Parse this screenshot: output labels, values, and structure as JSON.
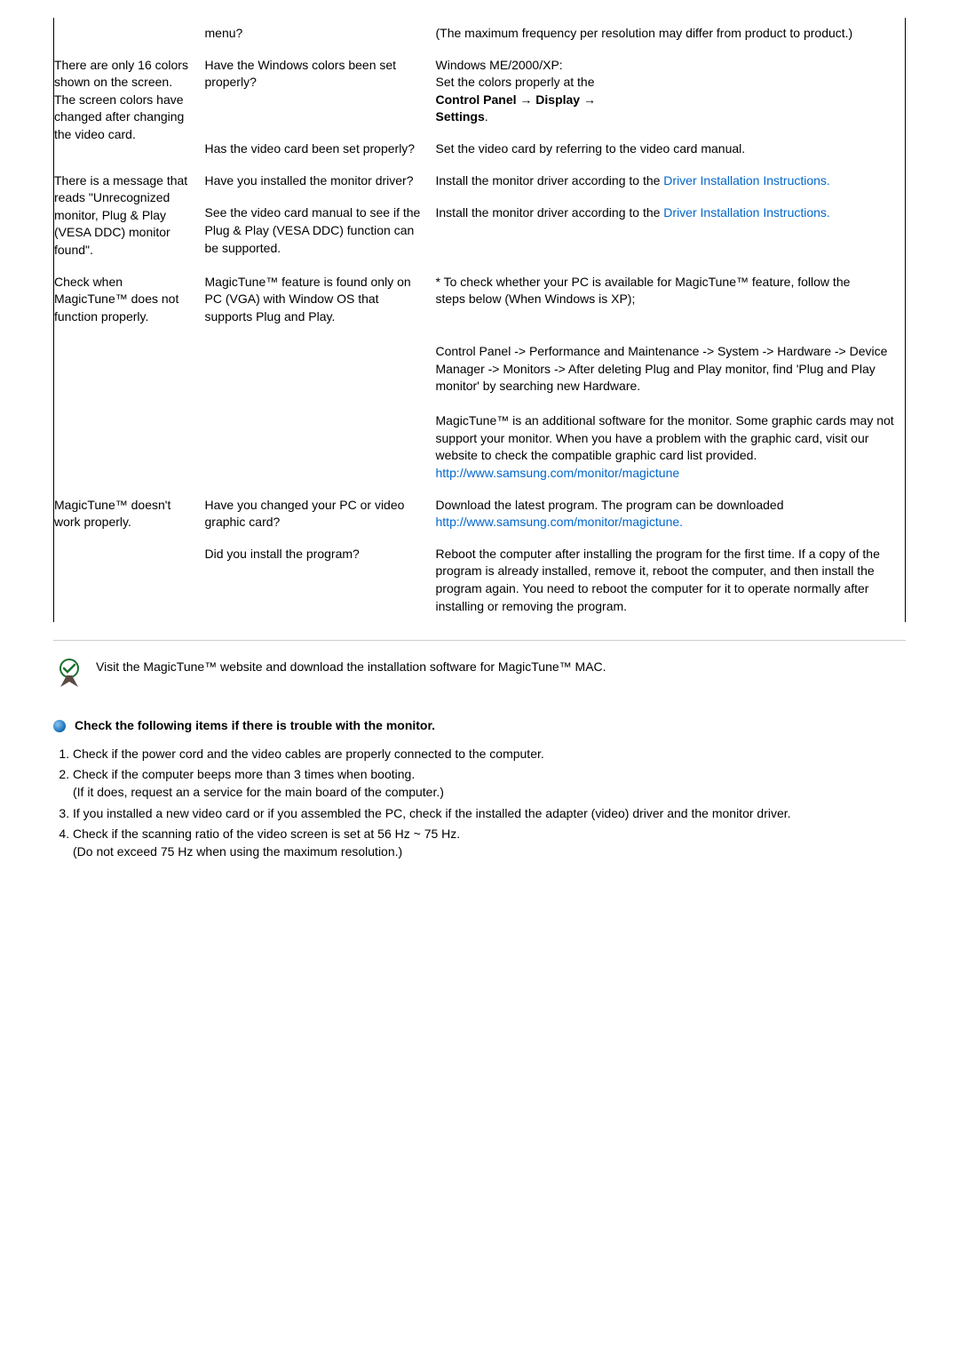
{
  "rows": [
    {
      "symptoms": [
        ""
      ],
      "checks": [
        "menu?"
      ],
      "solutions": [
        "(The maximum frequency per resolution may differ from product to product.)"
      ]
    },
    {
      "symptoms": [
        "There are only 16 colors shown on the screen. The screen colors have changed after changing the video card."
      ],
      "checks": [
        "Have the Windows colors been set properly?",
        "Has the video card been set properly?"
      ],
      "solutions": [
        "__SOL_WINDOWS__",
        "Set the video card by referring to the video card manual."
      ]
    },
    {
      "symptoms": [
        "There is a message that reads \"Unrecognized monitor, Plug & Play (VESA DDC) monitor found\"."
      ],
      "checks": [
        "Have you installed the monitor driver?",
        "See the video card manual to see if the Plug & Play (VESA DDC) function can be supported."
      ],
      "solutions": [
        "__SOL_DRIVER__",
        "__SOL_DRIVER__"
      ]
    },
    {
      "symptoms": [
        "Check when MagicTune™ does not function properly."
      ],
      "checks": [
        "MagicTune™ feature is found only on PC (VGA) with Window OS that supports Plug and Play."
      ],
      "solutions": [
        "__SOL_MAGICTUNE__"
      ]
    },
    {
      "symptoms": [
        "MagicTune™ doesn't work properly."
      ],
      "checks": [
        "Have you changed your PC or video graphic card?",
        "Did you install the program?"
      ],
      "solutions": [
        "__SOL_DOWNLOAD__",
        "Reboot the computer after installing the program for the first time. If a copy of the program is already installed, remove it, reboot the computer, and then install the program again. You need to reboot the computer for it to operate normally after installing or removing the program."
      ]
    }
  ],
  "sol_windows": {
    "line1": "Windows ME/2000/XP:",
    "line2": "Set the colors properly at the",
    "bold1": "Control Panel",
    "arrow": " → ",
    "bold2": "Display",
    "bold3": "Settings",
    "dot": "."
  },
  "sol_driver": {
    "line1": "Install the monitor driver according to the ",
    "link_text": "Driver Installation Instructions.",
    "href": "#"
  },
  "sol_magictune": {
    "p1_l1": "* To check whether your PC is available for MagicTune™ feature, follow the",
    "p1_indent": " steps below (When Windows is XP);",
    "p2": "Control Panel -> Performance and Maintenance -> System -> Hardware -> Device Manager -> Monitors -> After deleting Plug and Play monitor, find 'Plug and Play monitor' by searching new Hardware.",
    "p3": "MagicTune™ is an additional software for the monitor. Some graphic cards may not support your monitor. When you have a problem with the graphic card, visit our website to check the compatible graphic card list provided.",
    "p3_link": "http://www.samsung.com/monitor/magictune"
  },
  "sol_download": {
    "text": "Download the latest program. The program can be downloaded ",
    "link": "http://www.samsung.com/monitor/magictune."
  },
  "visit_text": " Visit the MagicTune™ website and download the installation software for MagicTune™ MAC.",
  "check_heading": "Check the following items if there is trouble with the monitor.",
  "checks_list": [
    {
      "main": "Check if the power cord and the video cables are properly connected to the computer."
    },
    {
      "main": "Check if the computer beeps more than 3 times when booting.",
      "sub": "(If it does, request an a service for the main board of the computer.)"
    },
    {
      "main": "If you installed a new video card or if you assembled the PC, check if the installed the adapter (video) driver and the monitor driver."
    },
    {
      "main": "Check if the scanning ratio of the video screen is set at 56 Hz ~ 75 Hz.",
      "sub": "(Do not exceed 75 Hz when using the maximum resolution.)"
    }
  ]
}
